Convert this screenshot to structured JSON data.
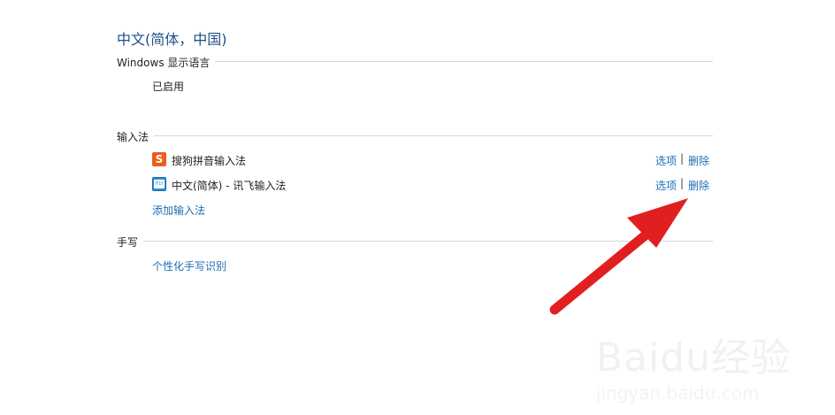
{
  "page": {
    "title": "中文(简体，中国)"
  },
  "display_language": {
    "heading": "Windows 显示语言",
    "status": "已启用"
  },
  "input_methods": {
    "heading": "输入法",
    "items": [
      {
        "name": "搜狗拼音输入法",
        "icon": "sogou-s-icon",
        "options_label": "选项",
        "separator": "|",
        "delete_label": "删除"
      },
      {
        "name": "中文(简体) - 讯飞输入法",
        "icon": "ifly-icon",
        "options_label": "选项",
        "separator": "|",
        "delete_label": "删除"
      }
    ],
    "add_label": "添加输入法"
  },
  "handwriting": {
    "heading": "手写",
    "personalize_label": "个性化手写识别"
  },
  "watermark": {
    "brand": "Baidu经验",
    "domain": "jingyan.baidu.com"
  },
  "annotation": {
    "arrow_color": "#e02020"
  },
  "colors": {
    "link": "#1e6fb5",
    "title": "#1f4f86",
    "rule": "#d6d6d6"
  }
}
